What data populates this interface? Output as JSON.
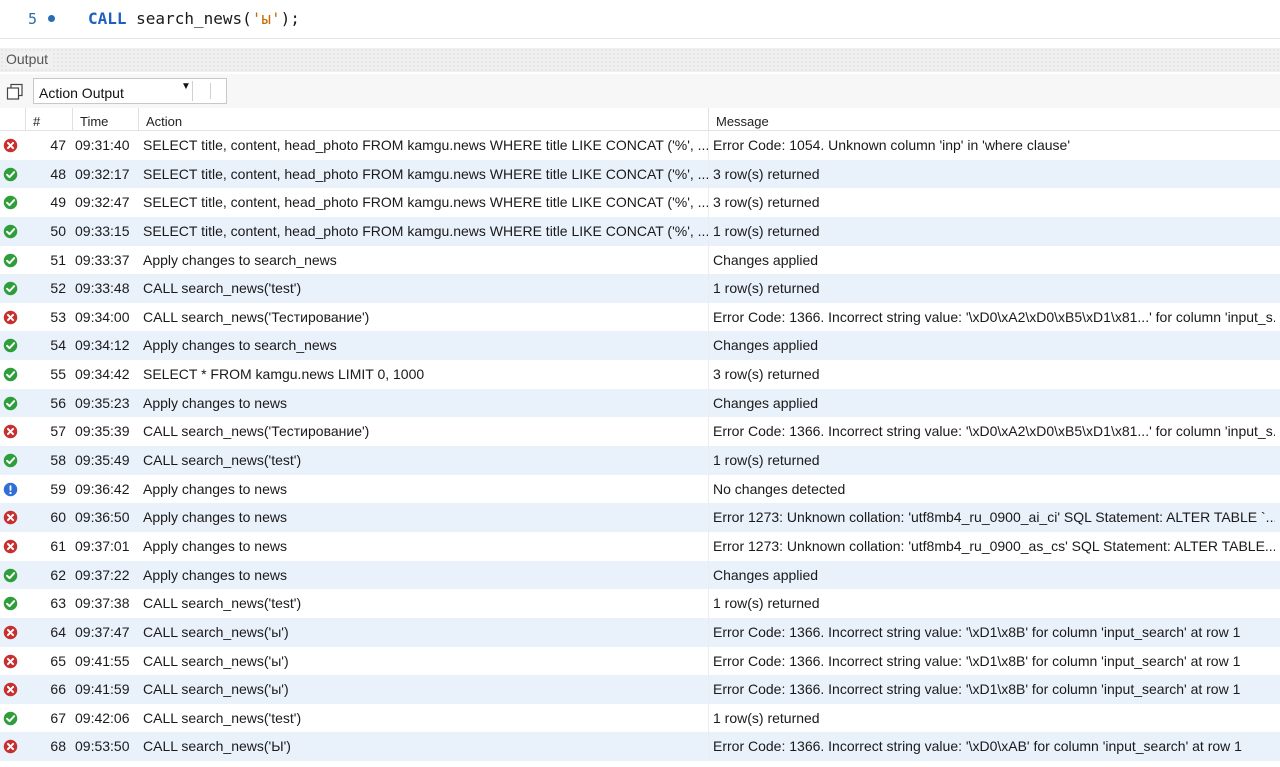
{
  "editor": {
    "line_number": "5",
    "code_keyword": "CALL",
    "code_fn": " search_news(",
    "code_str": "'ы'",
    "code_end": ");"
  },
  "output": {
    "title": "Output",
    "dropdown_value": "Action Output"
  },
  "columns": {
    "num": "#",
    "time": "Time",
    "action": "Action",
    "message": "Message"
  },
  "rows": [
    {
      "status": "error",
      "num": "47",
      "time": "09:31:40",
      "action": "SELECT title, content, head_photo FROM kamgu.news WHERE title LIKE CONCAT ('%', ...",
      "message": "Error Code: 1054. Unknown column 'inp' in 'where clause'"
    },
    {
      "status": "ok",
      "num": "48",
      "time": "09:32:17",
      "action": "SELECT title, content, head_photo FROM kamgu.news WHERE title LIKE CONCAT ('%', ...",
      "message": "3 row(s) returned"
    },
    {
      "status": "ok",
      "num": "49",
      "time": "09:32:47",
      "action": "SELECT title, content, head_photo FROM kamgu.news WHERE title LIKE CONCAT ('%', ...",
      "message": "3 row(s) returned"
    },
    {
      "status": "ok",
      "num": "50",
      "time": "09:33:15",
      "action": "SELECT title, content, head_photo FROM kamgu.news WHERE title LIKE CONCAT ('%', ...",
      "message": "1 row(s) returned"
    },
    {
      "status": "ok",
      "num": "51",
      "time": "09:33:37",
      "action": "Apply changes to search_news",
      "message": "Changes applied"
    },
    {
      "status": "ok",
      "num": "52",
      "time": "09:33:48",
      "action": "CALL search_news('test')",
      "message": "1 row(s) returned"
    },
    {
      "status": "error",
      "num": "53",
      "time": "09:34:00",
      "action": "CALL search_news('Тестирование')",
      "message": "Error Code: 1366. Incorrect string value: '\\xD0\\xA2\\xD0\\xB5\\xD1\\x81...' for column 'input_s..."
    },
    {
      "status": "ok",
      "num": "54",
      "time": "09:34:12",
      "action": "Apply changes to search_news",
      "message": "Changes applied"
    },
    {
      "status": "ok",
      "num": "55",
      "time": "09:34:42",
      "action": "SELECT * FROM kamgu.news LIMIT 0, 1000",
      "message": "3 row(s) returned"
    },
    {
      "status": "ok",
      "num": "56",
      "time": "09:35:23",
      "action": "Apply changes to news",
      "message": "Changes applied"
    },
    {
      "status": "error",
      "num": "57",
      "time": "09:35:39",
      "action": "CALL search_news('Тестирование')",
      "message": "Error Code: 1366. Incorrect string value: '\\xD0\\xA2\\xD0\\xB5\\xD1\\x81...' for column 'input_s..."
    },
    {
      "status": "ok",
      "num": "58",
      "time": "09:35:49",
      "action": "CALL search_news('test')",
      "message": "1 row(s) returned"
    },
    {
      "status": "info",
      "num": "59",
      "time": "09:36:42",
      "action": "Apply changes to news",
      "message": "No changes detected"
    },
    {
      "status": "error",
      "num": "60",
      "time": "09:36:50",
      "action": "Apply changes to news",
      "message": "Error 1273: Unknown collation: 'utf8mb4_ru_0900_ai_ci' SQL Statement: ALTER TABLE `..."
    },
    {
      "status": "error",
      "num": "61",
      "time": "09:37:01",
      "action": "Apply changes to news",
      "message": "Error 1273: Unknown collation: 'utf8mb4_ru_0900_as_cs' SQL Statement: ALTER TABLE..."
    },
    {
      "status": "ok",
      "num": "62",
      "time": "09:37:22",
      "action": "Apply changes to news",
      "message": "Changes applied"
    },
    {
      "status": "ok",
      "num": "63",
      "time": "09:37:38",
      "action": "CALL search_news('test')",
      "message": "1 row(s) returned"
    },
    {
      "status": "error",
      "num": "64",
      "time": "09:37:47",
      "action": "CALL search_news('ы')",
      "message": "Error Code: 1366. Incorrect string value: '\\xD1\\x8B' for column 'input_search' at row 1"
    },
    {
      "status": "error",
      "num": "65",
      "time": "09:41:55",
      "action": "CALL search_news('ы')",
      "message": "Error Code: 1366. Incorrect string value: '\\xD1\\x8B' for column 'input_search' at row 1"
    },
    {
      "status": "error",
      "num": "66",
      "time": "09:41:59",
      "action": "CALL search_news('ы')",
      "message": "Error Code: 1366. Incorrect string value: '\\xD1\\x8B' for column 'input_search' at row 1"
    },
    {
      "status": "ok",
      "num": "67",
      "time": "09:42:06",
      "action": "CALL search_news('test')",
      "message": "1 row(s) returned"
    },
    {
      "status": "error",
      "num": "68",
      "time": "09:53:50",
      "action": "CALL search_news('Ы')",
      "message": "Error Code: 1366. Incorrect string value: '\\xD0\\xAB' for column 'input_search' at row 1"
    }
  ],
  "colors": {
    "ok": "#2e9e3a",
    "error": "#c8302f",
    "info": "#2f6fd6",
    "row_alt": "#e9f1fb"
  }
}
